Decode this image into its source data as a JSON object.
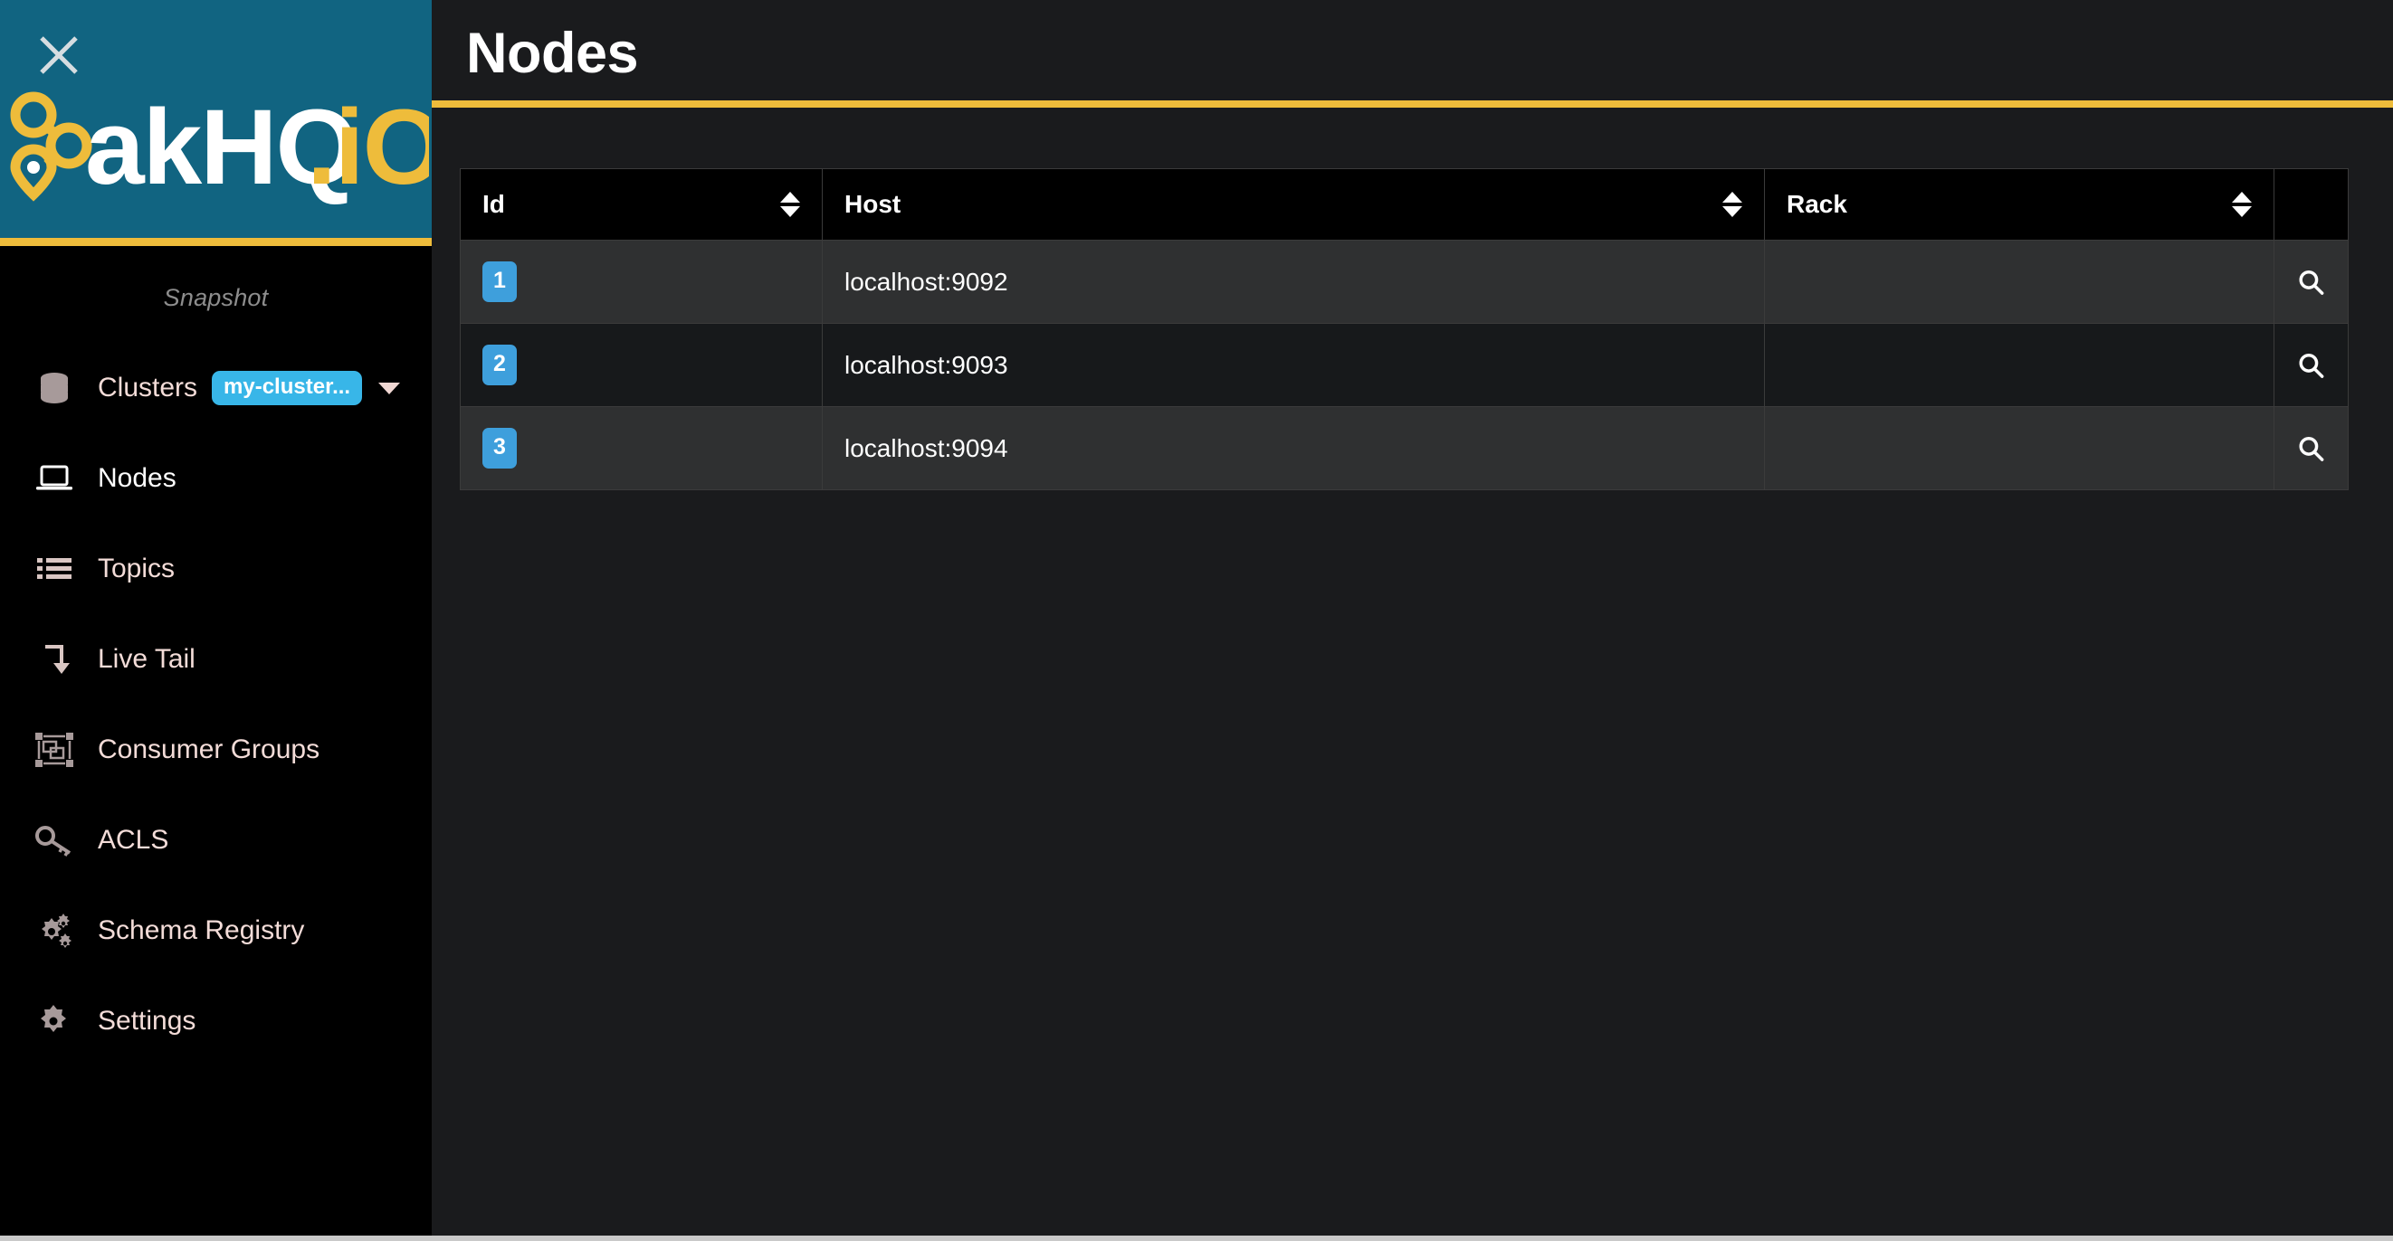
{
  "sidebar": {
    "close_icon": "close-x-icon",
    "brand": {
      "logo_text": "akHQ.io",
      "logo_icon": "akhq-network-logo-icon"
    },
    "snapshot_label": "Snapshot",
    "items": [
      {
        "label": "Clusters",
        "icon": "database-stack-icon",
        "active": false,
        "badge": "my-cluster...",
        "has_caret": true
      },
      {
        "label": "Nodes",
        "icon": "laptop-icon",
        "active": true
      },
      {
        "label": "Topics",
        "icon": "list-icon",
        "active": false
      },
      {
        "label": "Live Tail",
        "icon": "arrow-down-tail-icon",
        "active": false
      },
      {
        "label": "Consumer Groups",
        "icon": "object-group-icon",
        "active": false
      },
      {
        "label": "ACLS",
        "icon": "key-icon",
        "active": false
      },
      {
        "label": "Schema Registry",
        "icon": "cogs-icon",
        "active": false
      },
      {
        "label": "Settings",
        "icon": "gear-icon",
        "active": false
      }
    ]
  },
  "header": {
    "title": "Nodes"
  },
  "table": {
    "columns": [
      {
        "label": "Id",
        "sortable": true
      },
      {
        "label": "Host",
        "sortable": true
      },
      {
        "label": "Rack",
        "sortable": true
      },
      {
        "label": "",
        "sortable": false
      }
    ],
    "rows": [
      {
        "id": "1",
        "host": "localhost:9092",
        "rack": "",
        "action_icon": "search-icon"
      },
      {
        "id": "2",
        "host": "localhost:9093",
        "rack": "",
        "action_icon": "search-icon"
      },
      {
        "id": "3",
        "host": "localhost:9094",
        "rack": "",
        "action_icon": "search-icon"
      }
    ]
  },
  "colors": {
    "brand_teal": "#116481",
    "brand_yellow": "#eebc3b",
    "badge_blue": "#3e9fdc",
    "cluster_badge_blue": "#38b6e8",
    "nav_text": "#f3dcd8",
    "page_bg": "#1a1b1d"
  }
}
